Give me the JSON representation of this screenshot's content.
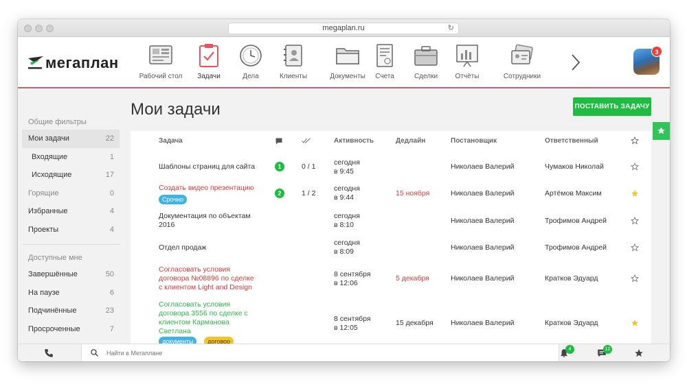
{
  "browser": {
    "url": "megaplan.ru"
  },
  "app": {
    "logo_text": "мегаплан"
  },
  "nav": {
    "items": [
      {
        "label": "Рабочий стол"
      },
      {
        "label": "Задачи"
      },
      {
        "label": "Дела"
      },
      {
        "label": "Клиенты"
      },
      {
        "label": "Документы"
      },
      {
        "label": "Счета"
      },
      {
        "label": "Сделки"
      },
      {
        "label": "Отчёты"
      },
      {
        "label": "Сотрудники"
      }
    ],
    "active": "Задачи"
  },
  "user": {
    "notification_count": "3"
  },
  "page": {
    "title": "Мои задачи",
    "create_button": "ПОСТАВИТЬ ЗАДАЧУ"
  },
  "sidebar": {
    "section1": "Общие фильтры",
    "items1": [
      {
        "label": "Мои задачи",
        "count": "22"
      },
      {
        "label": "Входящие",
        "count": "1"
      },
      {
        "label": "Исходящие",
        "count": "17"
      },
      {
        "label": "Горящие",
        "count": "0"
      },
      {
        "label": "Избранные",
        "count": "4"
      },
      {
        "label": "Проекты",
        "count": "4"
      }
    ],
    "section2": "Доступные мне",
    "items2": [
      {
        "label": "Завершённые",
        "count": "50"
      },
      {
        "label": "На паузе",
        "count": "6"
      },
      {
        "label": "Подчинённые",
        "count": "23"
      },
      {
        "label": "Просроченные",
        "count": "7"
      }
    ]
  },
  "table": {
    "headers": {
      "task": "Задача",
      "activity": "Активность",
      "deadline": "Дедлайн",
      "author": "Постановщик",
      "responsible": "Ответственный"
    },
    "rows": [
      {
        "task": "Шаблоны страниц для сайта",
        "comments": "1",
        "progress": "0 / 1",
        "activity": "сегодня\nв 9:45",
        "deadline": "",
        "author": "Николаев Валерий",
        "responsible": "Чумаков Николай",
        "starred": false
      },
      {
        "task": "Создать видео презентацию",
        "tag": "Срочно",
        "comments": "2",
        "progress": "1 / 2",
        "activity": "сегодня\nв 9:44",
        "deadline": "15 ноября",
        "author": "Николаев Валерий",
        "responsible": "Артёмов Максим",
        "starred": true
      },
      {
        "task": "Документация по объектам\n2016",
        "activity": "сегодня\nв 8:10",
        "deadline": "",
        "author": "Николаев Валерий",
        "responsible": "Трофимов Андрей",
        "starred": false
      },
      {
        "task": "Отдел продаж",
        "activity": "сегодня\nв 8:09",
        "deadline": "",
        "author": "Николаев Валерий",
        "responsible": "Трофимов Андрей",
        "starred": false
      },
      {
        "task": "Согласовать условия\nдоговора №08896 по сделке\nс клиентом Light and Design",
        "activity": "8 сентября\nв 12:06",
        "deadline": "5 декабря",
        "author": "Николаев Валерий",
        "responsible": "Кратков Эдуард",
        "starred": false
      },
      {
        "task": "Согласовать условия\nдоговора 3556 по сделке с\nклиентом Карманова\nСветлана",
        "tags": [
          "документы",
          "договор"
        ],
        "activity": "8 сентября\nв 12:05",
        "deadline": "15 декабря",
        "author": "Николаев Валерий",
        "responsible": "Кратков Эдуард",
        "starred": true
      }
    ]
  },
  "bottombar": {
    "search_placeholder": "Найти в Мегаплане",
    "notifications": "4",
    "messages": "12"
  },
  "colors": {
    "accent": "#e8545e",
    "green": "#1ebc40",
    "red": "#d43a3a",
    "tag_blue": "#3fb3e8",
    "tag_yellow": "#f5c227"
  }
}
